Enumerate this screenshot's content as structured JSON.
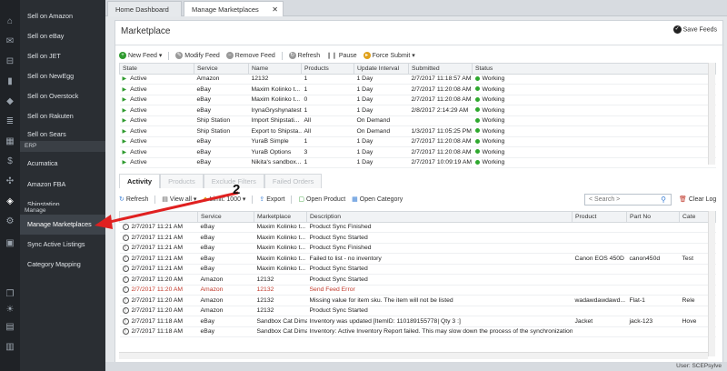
{
  "sidebar": {
    "items": [
      {
        "label": "Sell on Amazon"
      },
      {
        "label": "Sell on eBay"
      },
      {
        "label": "Sell on JET"
      },
      {
        "label": "Sell on NewEgg"
      },
      {
        "label": "Sell on Overstock"
      },
      {
        "label": "Sell on Rakuten"
      },
      {
        "label": "Sell on Sears"
      }
    ],
    "erp_label": "ERP",
    "erp_items": [
      {
        "label": "Acumatica"
      },
      {
        "label": "Amazon FBA"
      },
      {
        "label": "Shipstation"
      }
    ],
    "manage_label": "Manage",
    "manage_items": [
      {
        "label": "Manage Marketplaces"
      },
      {
        "label": "Sync Active Listings"
      },
      {
        "label": "Category Mapping"
      }
    ]
  },
  "tabs": {
    "home": "Home Dashboard",
    "manage": "Manage Marketplaces",
    "close": "✕"
  },
  "panel": {
    "title": "Marketplace",
    "save_feeds": "Save Feeds"
  },
  "toolbar": {
    "new_feed": "New Feed",
    "modify_feed": "Modify Feed",
    "remove_feed": "Remove Feed",
    "refresh": "Refresh",
    "pause": "Pause",
    "force_submit": "Force Submit"
  },
  "feeds": {
    "columns": [
      "State",
      "Service",
      "Name",
      "Products",
      "Update Interval",
      "Submitted",
      "Status"
    ],
    "rows": [
      {
        "state": "Active",
        "service": "Amazon",
        "name": "12132",
        "products": "1",
        "interval": "1 Day",
        "submitted": "2/7/2017 11:18:57 AM",
        "status": "Working"
      },
      {
        "state": "Active",
        "service": "eBay",
        "name": "Maxim Kolinko t...",
        "products": "1",
        "interval": "1 Day",
        "submitted": "2/7/2017 11:20:08 AM",
        "status": "Working"
      },
      {
        "state": "Active",
        "service": "eBay",
        "name": "Maxim Kolinko t...",
        "products": "0",
        "interval": "1 Day",
        "submitted": "2/7/2017 11:20:08 AM",
        "status": "Working"
      },
      {
        "state": "Active",
        "service": "eBay",
        "name": "IrynaGryshynatest",
        "products": "1",
        "interval": "1 Day",
        "submitted": "2/8/2017 2:14:29 AM",
        "status": "Working"
      },
      {
        "state": "Active",
        "service": "Ship Station",
        "name": "Import Shipstati...",
        "products": "All",
        "interval": "On Demand",
        "submitted": "",
        "status": "Working"
      },
      {
        "state": "Active",
        "service": "Ship Station",
        "name": "Export to Shipsta...",
        "products": "All",
        "interval": "On Demand",
        "submitted": "1/3/2017 11:05:25 PM",
        "status": "Working"
      },
      {
        "state": "Active",
        "service": "eBay",
        "name": "YuraB Simple",
        "products": "1",
        "interval": "1 Day",
        "submitted": "2/7/2017 11:20:08 AM",
        "status": "Working"
      },
      {
        "state": "Active",
        "service": "eBay",
        "name": "YuraB Options",
        "products": "3",
        "interval": "1 Day",
        "submitted": "2/7/2017 11:20:08 AM",
        "status": "Working"
      },
      {
        "state": "Active",
        "service": "eBay",
        "name": "Nikita's sandbox...",
        "products": "1",
        "interval": "1 Day",
        "submitted": "2/7/2017 10:09:19 AM",
        "status": "Working"
      }
    ]
  },
  "activity_tabs": [
    "Activity",
    "Products",
    "Exclude Filters",
    "Failed Orders"
  ],
  "activity_toolbar": {
    "refresh": "Refresh",
    "view_all": "View all",
    "limit": "Limit: 1000",
    "export": "Export",
    "open_product": "Open Product",
    "open_category": "Open Category",
    "search_placeholder": "< Search >",
    "clear_log": "Clear Log"
  },
  "activity": {
    "columns": [
      "",
      "Service",
      "Marketplace",
      "Description",
      "Product",
      "Part No",
      "Cate"
    ],
    "rows": [
      {
        "time": "2/7/2017 11:21 AM",
        "service": "eBay",
        "marketplace": "Maxim Kolinko t...",
        "description": "Product Sync Finished",
        "product": "",
        "part": "",
        "cat": "",
        "error": false
      },
      {
        "time": "2/7/2017 11:21 AM",
        "service": "eBay",
        "marketplace": "Maxim Kolinko t...",
        "description": "Product Sync Started",
        "product": "",
        "part": "",
        "cat": "",
        "error": false
      },
      {
        "time": "2/7/2017 11:21 AM",
        "service": "eBay",
        "marketplace": "Maxim Kolinko t...",
        "description": "Product Sync Finished",
        "product": "",
        "part": "",
        "cat": "",
        "error": false
      },
      {
        "time": "2/7/2017 11:21 AM",
        "service": "eBay",
        "marketplace": "Maxim Kolinko t...",
        "description": "Failed to list - no inventory",
        "product": "Canon EOS 450D",
        "part": "canon450d",
        "cat": "Test",
        "error": false
      },
      {
        "time": "2/7/2017 11:21 AM",
        "service": "eBay",
        "marketplace": "Maxim Kolinko t...",
        "description": "Product Sync Started",
        "product": "",
        "part": "",
        "cat": "",
        "error": false
      },
      {
        "time": "2/7/2017 11:20 AM",
        "service": "Amazon",
        "marketplace": "12132",
        "description": "Product Sync Started",
        "product": "",
        "part": "",
        "cat": "",
        "error": false
      },
      {
        "time": "2/7/2017 11:20 AM",
        "service": "Amazon",
        "marketplace": "12132",
        "description": "Send Feed Error",
        "product": "",
        "part": "",
        "cat": "",
        "error": true
      },
      {
        "time": "2/7/2017 11:20 AM",
        "service": "Amazon",
        "marketplace": "12132",
        "description": "Missing value for item sku. The item will not be listed",
        "product": "wadawdawdawd...",
        "part": "Flat-1",
        "cat": "Rele",
        "error": false
      },
      {
        "time": "2/7/2017 11:20 AM",
        "service": "Amazon",
        "marketplace": "12132",
        "description": "Product Sync Started",
        "product": "",
        "part": "",
        "cat": "",
        "error": false
      },
      {
        "time": "2/7/2017 11:18 AM",
        "service": "eBay",
        "marketplace": "Sandbox Cat Dima",
        "description": "Inventory was updated [ItemID: 110189155778| Qty 3 :]",
        "product": "Jacket",
        "part": "jack-123",
        "cat": "Hove",
        "error": false
      },
      {
        "time": "2/7/2017 11:18 AM",
        "service": "eBay",
        "marketplace": "Sandbox Cat Dima",
        "description": "Inventory: Active Inventory Report failed. This may slow down the process of the synchronization,...",
        "product": "",
        "part": "",
        "cat": "",
        "error": false
      }
    ]
  },
  "annotation": {
    "number": "2"
  },
  "footer": {
    "user": "User: SCEPsylve"
  },
  "colors": {
    "accent_green": "#2ea82e",
    "error_red": "#c0392b",
    "sidebar_bg": "#2a2e33"
  }
}
